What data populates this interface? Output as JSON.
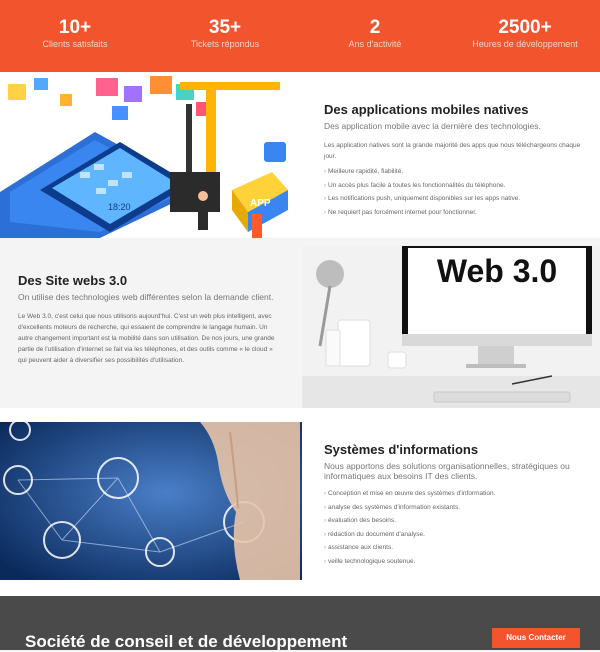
{
  "stats": [
    {
      "value": "10+",
      "label": "Clients satisfaits"
    },
    {
      "value": "35+",
      "label": "Tickets répondus"
    },
    {
      "value": "2",
      "label": "Ans d'activité"
    },
    {
      "value": "2500+",
      "label": "Heures de développement"
    }
  ],
  "mobile": {
    "title": "Des applications mobiles natives",
    "subtitle": "Des application mobile avec la dernière des technologies.",
    "intro": "Les application natives sont la grande majorité des apps que nous téléchargeons chaque jour.",
    "items": [
      "Meilleure rapidité, fiabilité.",
      "Un accès plus facile à toutes les fonctionnalités du téléphone.",
      "Les notifications push, uniquement disponibles sur les apps native.",
      "Ne requiert pas forcément internet pour fonctionner."
    ],
    "phone_time": "18:20",
    "app_label": "APP"
  },
  "web": {
    "title": "Des Site webs 3.0",
    "subtitle": "On utilise des technologies web différentes selon la demande client.",
    "paragraph": "Le Web 3.0, c'est celui que nous utilisons aujourd'hui. C'est un web plus intelligent, avec d'excellents moteurs de recherche, qui essaient de comprendre le langage humain. Un autre changement important est la mobilité dans son utilisation. De nos jours, une grande partie de l'utilisation d'internet se fait via les téléphones, et des outils comme « le cloud » qui peuvent aider à diversifier ses possibilités d'utilisation.",
    "screen_text": "Web 3.0"
  },
  "info": {
    "title": "Systèmes d'informations",
    "subtitle": "Nous apportons des solutions organisationnelles, stratégiques ou informatiques aux besoins IT des clients.",
    "items": [
      "Conception et mise en œuvre des systèmes d'information.",
      "analyse des systèmes d'information existants.",
      "évaluation des besoins.",
      "rédaction du document d'analyse.",
      "assistance aux clients.",
      "veille technologique soutenue."
    ]
  },
  "footer": {
    "title": "Société de conseil et de développement",
    "button": "Nous Contacter"
  },
  "colors": {
    "accent": "#f2542d",
    "footer_bg": "#4a4a4a",
    "text_dark": "#222222"
  }
}
